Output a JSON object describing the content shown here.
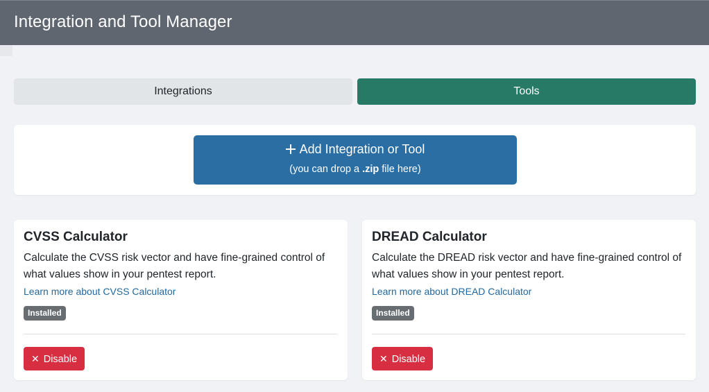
{
  "header": {
    "title": "Integration and Tool Manager"
  },
  "tabs": [
    {
      "label": "Integrations",
      "active": false
    },
    {
      "label": "Tools",
      "active": true
    }
  ],
  "upload": {
    "plus_glyph": "+",
    "label": "Add Integration or Tool",
    "hint_prefix": "(you can drop a ",
    "hint_ext": ".zip",
    "hint_suffix": " file here)"
  },
  "tools": [
    {
      "title": "CVSS Calculator",
      "description": "Calculate the CVSS risk vector and have fine-grained control of what values show in your pentest report.",
      "link": "Learn more about CVSS Calculator",
      "badge": "Installed",
      "action_icon": "✕",
      "action_label": "Disable"
    },
    {
      "title": "DREAD Calculator",
      "description": "Calculate the DREAD risk vector and have fine-grained control of what values show in your pentest report.",
      "link": "Learn more about DREAD Calculator",
      "badge": "Installed",
      "action_icon": "✕",
      "action_label": "Disable"
    }
  ],
  "colors": {
    "header_bg": "#5f6670",
    "active_tab": "#267a66",
    "primary_button": "#2a6ea3",
    "danger_button": "#d72f41",
    "badge": "#686d72",
    "link": "#2168a0"
  },
  "icons": {
    "add": "plus-icon",
    "disable": "close-icon"
  }
}
